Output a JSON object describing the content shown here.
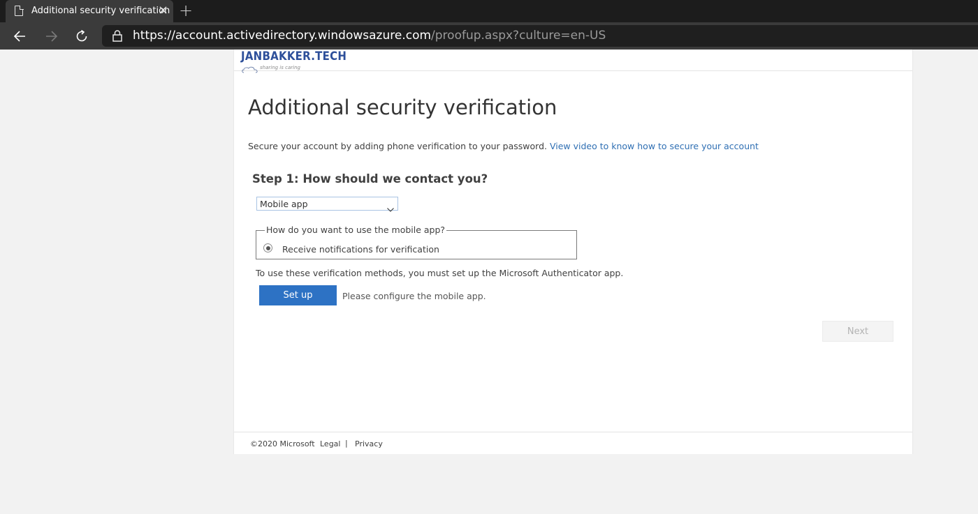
{
  "browser": {
    "tab_title": "Additional security verification",
    "tab_close": "×",
    "new_tab": "+",
    "url_main": "https://account.activedirectory.windowsazure.com",
    "url_rest": "/proofup.aspx?culture=en-US"
  },
  "header": {
    "logo_text": "JANBAKKER.TECH",
    "logo_tagline": "sharing is caring"
  },
  "main": {
    "title": "Additional security verification",
    "intro_text": "Secure your account by adding phone verification to your password.",
    "intro_link": "View video to know how to secure your account",
    "step_title": "Step 1: How should we contact you?",
    "contact_method": "Mobile app",
    "fieldset_legend": "How do you want to use the mobile app?",
    "radio_option": "Receive notifications for verification",
    "note": "To use these verification methods, you must set up the Microsoft Authenticator app.",
    "setup_button": "Set up",
    "setup_message": "Please configure the mobile app.",
    "next_button": "Next"
  },
  "footer": {
    "copyright": "©2020 Microsoft",
    "legal": "Legal",
    "separator": "|",
    "privacy": "Privacy"
  },
  "colors": {
    "accent": "#2d72c4",
    "link": "#2f6fb3",
    "chrome_dark": "#1c1c1c",
    "chrome_toolbar": "#3b3b3b"
  }
}
